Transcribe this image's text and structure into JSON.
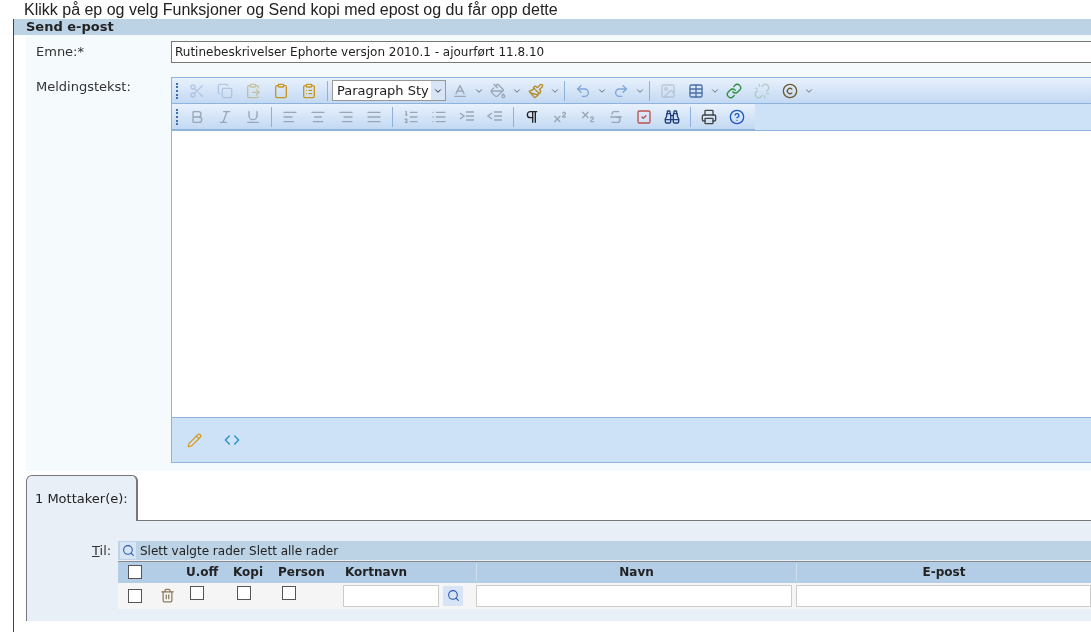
{
  "instruction": "Klikk på ep og velg Funksjoner og Send kopi med epost og du får opp dette",
  "panel_title": "Send e-post",
  "subject": {
    "label": "Emne:*",
    "value": "Rutinebeskrivelser Ephorte versjon 2010.1 - ajourført 11.8.10"
  },
  "message": {
    "label": "Meldingstekst:",
    "style_dropdown": "Paragraph Sty"
  },
  "tabs": [
    {
      "label": "1 Mottaker(e):",
      "selected": true
    }
  ],
  "recipients": {
    "to_label": "Til:",
    "actions": [
      "Slett valgte rader",
      "Slett alle rader"
    ],
    "select_all": {
      "checked": false
    },
    "columns": [
      "U.off",
      "Kopi",
      "Person",
      "Kortnavn",
      "Navn",
      "E-post"
    ],
    "rows": [
      {
        "selected": false,
        "u_off": false,
        "kopi": false,
        "person": false
      }
    ]
  }
}
